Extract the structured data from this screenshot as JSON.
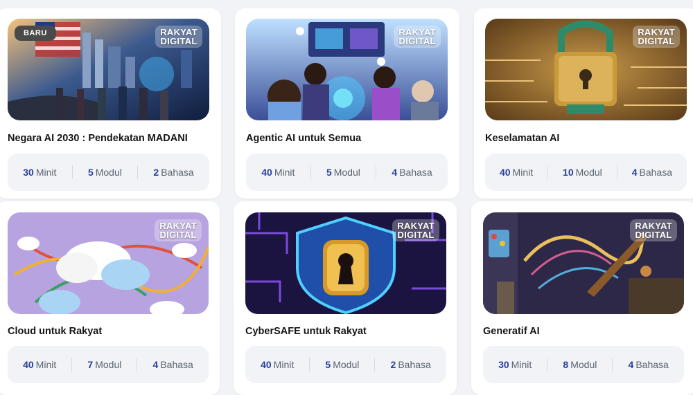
{
  "courses": [
    {
      "title": "Negara AI 2030 : Pendekatan MADANI",
      "badge": "BARU",
      "brand": [
        "RAKYAT",
        "DIGITAL"
      ],
      "minutes": "30",
      "minutes_unit": "Minit",
      "modules": "5",
      "modules_unit": "Modul",
      "languages": "2",
      "languages_unit": "Bahasa"
    },
    {
      "title": "Agentic AI untuk Semua",
      "brand": [
        "RAKYAT",
        "DIGITAL"
      ],
      "minutes": "40",
      "minutes_unit": "Minit",
      "modules": "5",
      "modules_unit": "Modul",
      "languages": "4",
      "languages_unit": "Bahasa"
    },
    {
      "title": "Keselamatan AI",
      "brand": [
        "RAKYAT",
        "DIGITAL"
      ],
      "minutes": "40",
      "minutes_unit": "Minit",
      "modules": "10",
      "modules_unit": "Modul",
      "languages": "4",
      "languages_unit": "Bahasa"
    },
    {
      "title": "Cloud untuk Rakyat",
      "brand": [
        "RAKYAT",
        "DIGITAL"
      ],
      "minutes": "40",
      "minutes_unit": "Minit",
      "modules": "7",
      "modules_unit": "Modul",
      "languages": "4",
      "languages_unit": "Bahasa"
    },
    {
      "title": "CyberSAFE untuk Rakyat",
      "brand": [
        "RAKYAT",
        "DIGITAL"
      ],
      "minutes": "40",
      "minutes_unit": "Minit",
      "modules": "5",
      "modules_unit": "Modul",
      "languages": "2",
      "languages_unit": "Bahasa"
    },
    {
      "title": "Generatif AI",
      "brand": [
        "RAKYAT",
        "DIGITAL"
      ],
      "minutes": "30",
      "minutes_unit": "Minit",
      "modules": "8",
      "modules_unit": "Modul",
      "languages": "4",
      "languages_unit": "Bahasa"
    }
  ],
  "colors": {
    "accent": "#2a3f9c",
    "page_bg": "#f1f3f6",
    "card_bg": "#ffffff",
    "stats_bg": "#f1f3f6"
  }
}
